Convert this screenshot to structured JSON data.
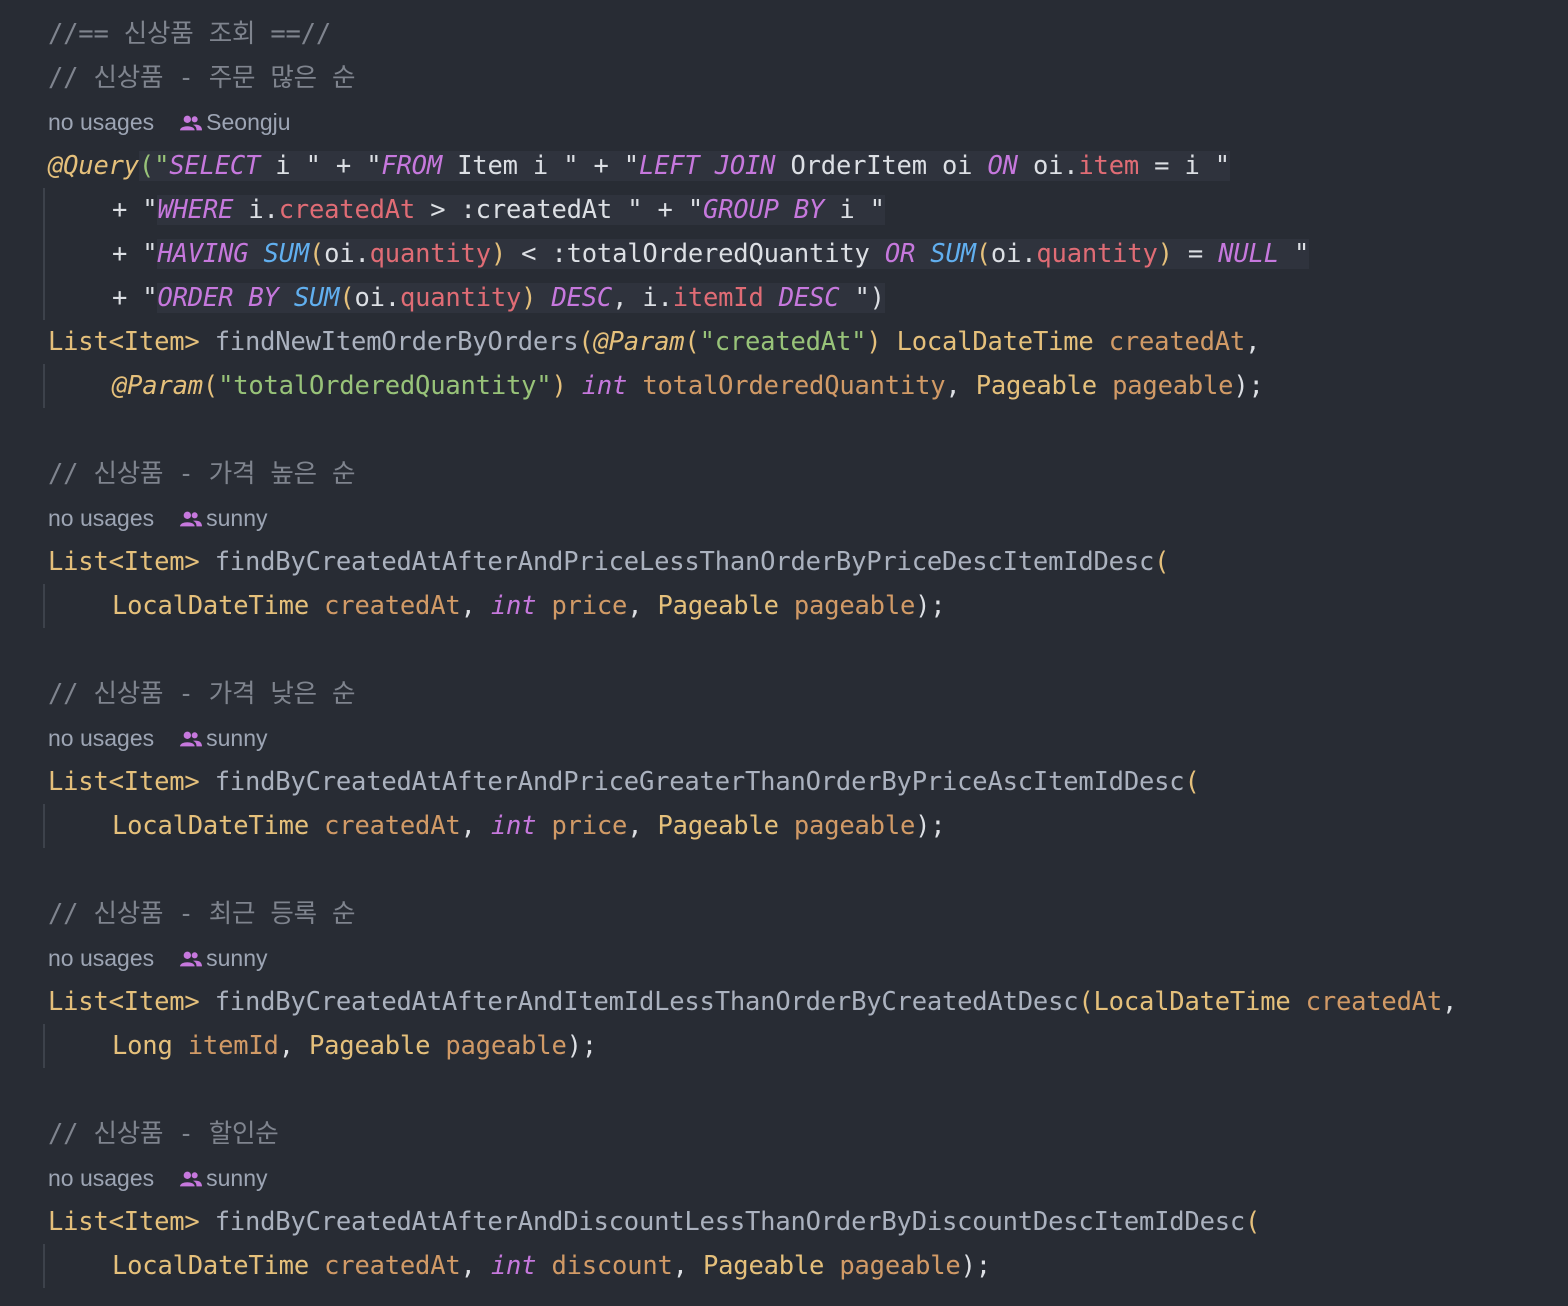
{
  "colors": {
    "background": "#282c34",
    "comment": "#7f848e",
    "keyword": "#c678dd",
    "type": "#e5c07b",
    "string": "#98c379",
    "function": "#61afef",
    "field": "#e06c75",
    "parameter": "#d19a66",
    "author_icon": "#c678dd"
  },
  "icons": {
    "author": "users-icon"
  },
  "section1": {
    "header_comment": "//== 신상품 조회 ==//",
    "comment": "// 신상품 - 주문 많은 순",
    "usages": "no usages",
    "author": "Seongju",
    "query": {
      "ann": "@Query",
      "p1": "(\"",
      "select": "SELECT",
      "t1": " i \" + \"",
      "from": "FROM",
      "t2": " Item i \" + \"",
      "leftjoin": "LEFT JOIN",
      "t3": " OrderItem oi ",
      "on": "ON",
      "t4": " oi.",
      "f_item": "item",
      "t5": " = i \"",
      "l2a": "+ \"",
      "where": "WHERE",
      "l2b": " i.",
      "f_createdAt": "createdAt",
      "l2c": " > :createdAt \" + \"",
      "groupby": "GROUP BY",
      "l2d": " i \"",
      "l3a": "+ \"",
      "having": "HAVING",
      "sum": "SUM",
      "paren_open": "(",
      "oi_dot": "oi.",
      "f_quantity": "quantity",
      "paren_close": ")",
      "l3b": " < :totalOrderedQuantity ",
      "or": "OR",
      "l3c": " = ",
      "null": "NULL",
      "l3d": " \"",
      "l4a": "+ \"",
      "orderby": "ORDER BY",
      "desc": "DESC",
      "l4b": ", i.",
      "f_itemId": "itemId",
      "l4c": " \")"
    },
    "sig": {
      "ret": "List<Item>",
      "name": "findNewItemOrderByOrders",
      "open": "(",
      "param_ann": "@Param",
      "name_arg1": "\"createdAt\"",
      "type1": "LocalDateTime",
      "p1": "createdAt",
      "comma": ",",
      "name_arg2": "\"totalOrderedQuantity\"",
      "kw_int": "int",
      "p2": "totalOrderedQuantity",
      "type3": "Pageable",
      "p3": "pageable",
      "end": ");"
    }
  },
  "section2": {
    "comment": "// 신상품 - 가격 높은 순",
    "usages": "no usages",
    "author": "sunny",
    "ret": "List<Item>",
    "name": "findByCreatedAtAfterAndPriceLessThanOrderByPriceDescItemIdDesc",
    "open": "(",
    "type1": "LocalDateTime",
    "p1": "createdAt",
    "kw": "int",
    "p2": "price",
    "type3": "Pageable",
    "p3": "pageable",
    "end": ");"
  },
  "section3": {
    "comment": "// 신상품 - 가격 낮은 순",
    "usages": "no usages",
    "author": "sunny",
    "ret": "List<Item>",
    "name": "findByCreatedAtAfterAndPriceGreaterThanOrderByPriceAscItemIdDesc",
    "open": "(",
    "type1": "LocalDateTime",
    "p1": "createdAt",
    "kw": "int",
    "p2": "price",
    "type3": "Pageable",
    "p3": "pageable",
    "end": ");"
  },
  "section4": {
    "comment": "// 신상품 - 최근 등록 순",
    "usages": "no usages",
    "author": "sunny",
    "ret": "List<Item>",
    "name": "findByCreatedAtAfterAndItemIdLessThanOrderByCreatedAtDesc",
    "open": "(",
    "type1": "LocalDateTime",
    "p1": "createdAt",
    "type2": "Long",
    "p2": "itemId",
    "type3": "Pageable",
    "p3": "pageable",
    "end": ");"
  },
  "section5": {
    "comment": "// 신상품 - 할인순",
    "usages": "no usages",
    "author": "sunny",
    "ret": "List<Item>",
    "name": "findByCreatedAtAfterAndDiscountLessThanOrderByDiscountDescItemIdDesc",
    "open": "(",
    "type1": "LocalDateTime",
    "p1": "createdAt",
    "kw": "int",
    "p2": "discount",
    "type3": "Pageable",
    "p3": "pageable",
    "end": ");"
  }
}
